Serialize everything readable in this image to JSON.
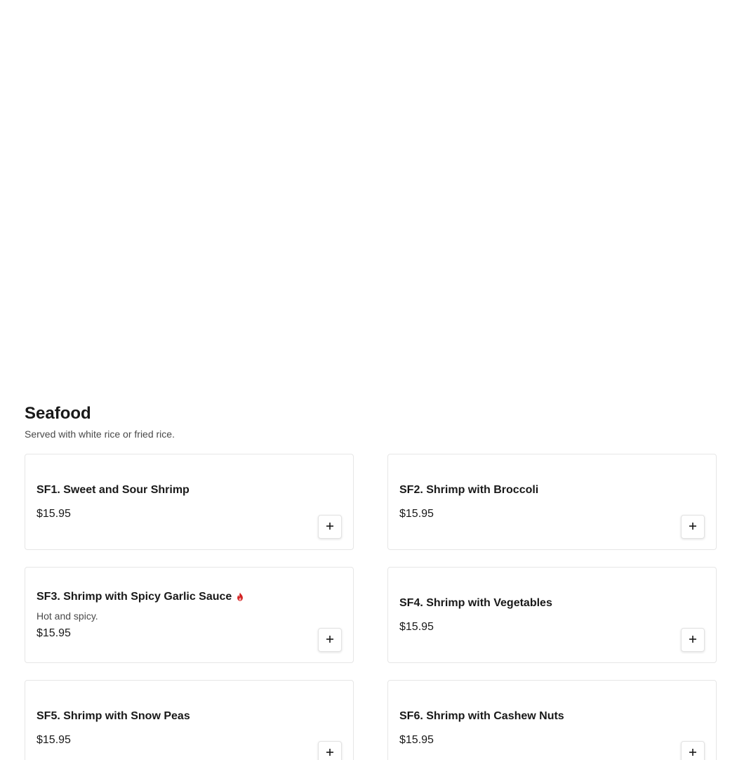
{
  "section": {
    "title": "Seafood",
    "description": "Served with white rice or fried rice."
  },
  "items": [
    {
      "name": "SF1. Sweet and Sour Shrimp",
      "price": "$15.95",
      "description": "",
      "spicy": false
    },
    {
      "name": "SF2. Shrimp with Broccoli",
      "price": "$15.95",
      "description": "",
      "spicy": false
    },
    {
      "name": "SF3. Shrimp with Spicy Garlic Sauce",
      "price": "$15.95",
      "description": "Hot and spicy.",
      "spicy": true
    },
    {
      "name": "SF4. Shrimp with Vegetables",
      "price": "$15.95",
      "description": "",
      "spicy": false
    },
    {
      "name": "SF5. Shrimp with Snow Peas",
      "price": "$15.95",
      "description": "",
      "spicy": false
    },
    {
      "name": "SF6. Shrimp with Cashew Nuts",
      "price": "$15.95",
      "description": "",
      "spicy": false
    }
  ],
  "icons": {
    "add": "plus-icon",
    "spicy": "chili-flame-icon"
  },
  "colors": {
    "text": "#191919",
    "muted_text": "#494949",
    "card_border": "#e6e6e6",
    "spicy": "#d32323"
  }
}
